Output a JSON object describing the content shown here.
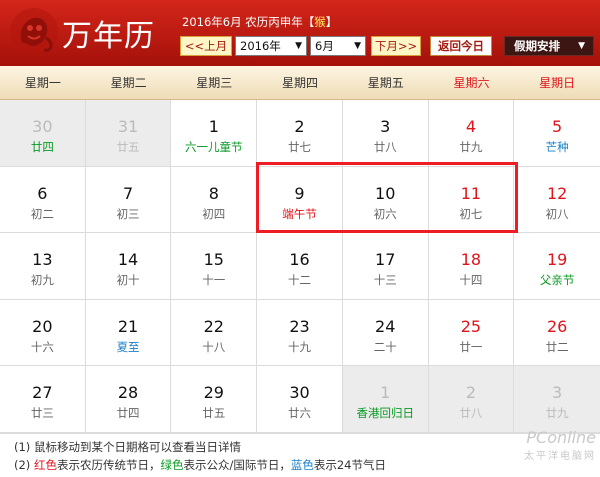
{
  "header": {
    "title": "万年历",
    "lunar_prefix": "2016年6月 农历丙申年【",
    "zodiac": "猴",
    "lunar_suffix": "】",
    "prev_label": "<<上月",
    "year_value": "2016年",
    "month_value": "6月",
    "next_label": "下月>>",
    "today_label": "返回今日",
    "holiday_label": "假期安排",
    "dropdown_arrow": "▼",
    "holiday_arrow": "▼"
  },
  "weekdays": [
    "星期一",
    "星期二",
    "星期三",
    "星期四",
    "星期五",
    "星期六",
    "星期日"
  ],
  "days": [
    {
      "d": "30",
      "l": "廿四",
      "other": true,
      "lc": "fest-green"
    },
    {
      "d": "31",
      "l": "廿五",
      "other": true
    },
    {
      "d": "1",
      "l": "六一儿童节",
      "lc": "fest-green"
    },
    {
      "d": "2",
      "l": "廿七"
    },
    {
      "d": "3",
      "l": "廿八"
    },
    {
      "d": "4",
      "l": "廿九",
      "wk": true
    },
    {
      "d": "5",
      "l": "芒种",
      "wk": true,
      "lc": "term-blue"
    },
    {
      "d": "6",
      "l": "初二"
    },
    {
      "d": "7",
      "l": "初三"
    },
    {
      "d": "8",
      "l": "初四"
    },
    {
      "d": "9",
      "l": "端午节",
      "lc": "fest-red"
    },
    {
      "d": "10",
      "l": "初六"
    },
    {
      "d": "11",
      "l": "初七",
      "wk": true
    },
    {
      "d": "12",
      "l": "初八",
      "wk": true
    },
    {
      "d": "13",
      "l": "初九"
    },
    {
      "d": "14",
      "l": "初十"
    },
    {
      "d": "15",
      "l": "十一"
    },
    {
      "d": "16",
      "l": "十二"
    },
    {
      "d": "17",
      "l": "十三"
    },
    {
      "d": "18",
      "l": "十四",
      "wk": true
    },
    {
      "d": "19",
      "l": "父亲节",
      "wk": true,
      "lc": "fest-green"
    },
    {
      "d": "20",
      "l": "十六"
    },
    {
      "d": "21",
      "l": "夏至",
      "lc": "term-blue"
    },
    {
      "d": "22",
      "l": "十八"
    },
    {
      "d": "23",
      "l": "十九"
    },
    {
      "d": "24",
      "l": "二十"
    },
    {
      "d": "25",
      "l": "廿一",
      "wk": true
    },
    {
      "d": "26",
      "l": "廿二",
      "wk": true
    },
    {
      "d": "27",
      "l": "廿三"
    },
    {
      "d": "28",
      "l": "廿四"
    },
    {
      "d": "29",
      "l": "廿五"
    },
    {
      "d": "30",
      "l": "廿六"
    },
    {
      "d": "1",
      "l": "香港回归日",
      "other": true,
      "lc": "fest-green"
    },
    {
      "d": "2",
      "l": "廿八",
      "other": true
    },
    {
      "d": "3",
      "l": "廿九",
      "other": true
    }
  ],
  "footer": {
    "line1": "(1) 鼠标移动到某个日期格可以查看当日详情",
    "line2_prefix": "(2) ",
    "red_word": "红色",
    "red_desc": "表示农历传统节日，",
    "green_word": "绿色",
    "green_desc": "表示公众/国际节日，",
    "blue_word": "蓝色",
    "blue_desc": "表示24节气日"
  },
  "watermark": {
    "brand": "PConline",
    "sub": "太平洋电脑网"
  },
  "colors": {
    "header_red": "#c41e14",
    "weekend_red": "#e0141a",
    "festival_green": "#0a9a24",
    "solar_term_blue": "#1a7fc8",
    "highlight_border": "#ee1c24"
  }
}
